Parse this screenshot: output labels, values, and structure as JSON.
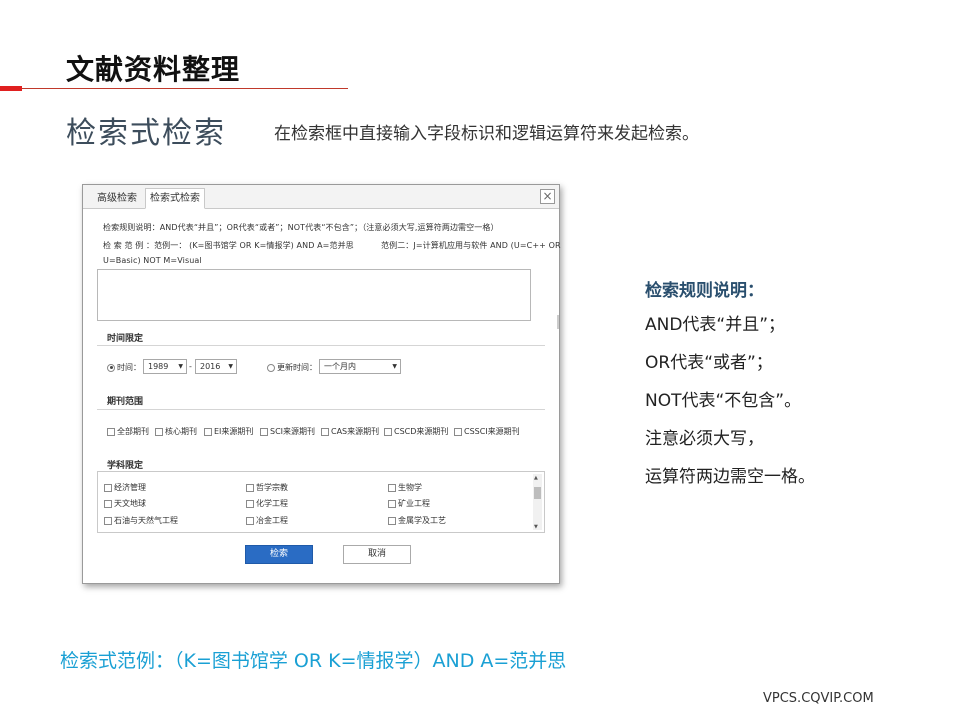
{
  "slide": {
    "title": "文献资料整理",
    "subtitle": "检索式检索",
    "description": "在检索框中直接输入字段标识和逻辑运算符来发起检索。"
  },
  "dialog": {
    "tabs": [
      "高级检索",
      "检索式检索"
    ],
    "close_icon": "×",
    "rules_line": "检索规则说明：AND代表“并且”；OR代表“或者”；NOT代表“不包含”；（注意必须大写,运算符两边需空一格）",
    "example_line1_left": "检 索 范 例 ：范例一：  (K=图书馆学 OR K=情报学) AND A=范并思",
    "example_line1_right": "范例二：J=计算机应用与软件 AND (U=C++ OR",
    "example_line2": "U=Basic) NOT M=Visual",
    "time_section": {
      "title": "时间限定",
      "time_label": "时间：",
      "from_year": "1989",
      "separator": "-",
      "to_year": "2016",
      "update_label": "更新时间：",
      "update_value": "一个月内"
    },
    "journal_section": {
      "title": "期刊范围",
      "options": [
        "全部期刊",
        "核心期刊",
        "EI来源期刊",
        "SCI来源期刊",
        "CAS来源期刊",
        "CSCD来源期刊",
        "CSSCI来源期刊"
      ]
    },
    "subject_section": {
      "title": "学科限定",
      "rows": [
        [
          "经济管理",
          "哲学宗教",
          "生物学"
        ],
        [
          "天文地球",
          "化学工程",
          "矿业工程"
        ],
        [
          "石油与天然气工程",
          "冶金工程",
          "金属学及工艺"
        ]
      ]
    },
    "search_label": "检索",
    "cancel_label": "取消"
  },
  "notes": {
    "title": "检索规则说明：",
    "lines": [
      "AND代表“并且”；",
      "OR代表“或者”；",
      "NOT代表“不包含”。",
      "注意必须大写，",
      "运算符两边需空一格。"
    ]
  },
  "example": "检索式范例：（K=图书馆学 OR K=情报学）AND A=范并思",
  "footer": "VPCS.CQVIP.COM",
  "colors": {
    "accent_red": "#e02020",
    "example_blue": "#1aa0d4",
    "notes_title": "#2a4f6e",
    "search_button": "#2a6cc4"
  }
}
